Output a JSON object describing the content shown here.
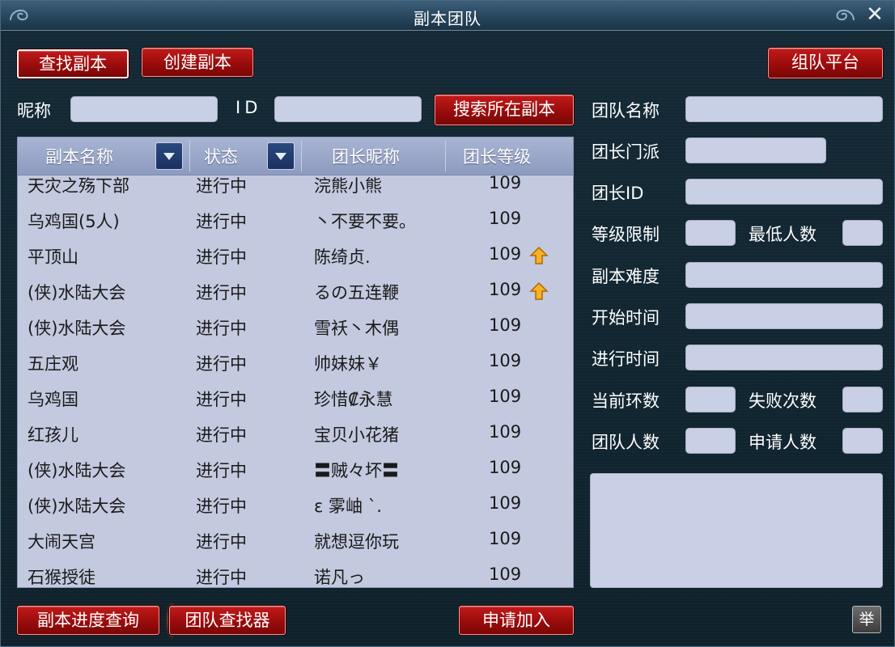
{
  "window": {
    "title": "副本团队",
    "close_glyph": "✕"
  },
  "toolbar": {
    "find_instance": "查找副本",
    "create_instance": "创建副本",
    "team_platform": "组队平台"
  },
  "search": {
    "nickname_label": "昵称",
    "nickname_value": "",
    "id_label": "ID",
    "id_value": "",
    "search_button": "搜索所在副本"
  },
  "list": {
    "columns": [
      "副本名称",
      "状态",
      "团长昵称",
      "团长等级"
    ],
    "rows": [
      {
        "name": "天灾之殇下部",
        "status": "进行中",
        "leader": "浣熊小熊",
        "level": "109",
        "up": false
      },
      {
        "name": "乌鸡国(5人)",
        "status": "进行中",
        "leader": "丶不要不要。",
        "level": "109",
        "up": false
      },
      {
        "name": "平顶山",
        "status": "进行中",
        "leader": "陈绮贞.",
        "level": "109",
        "up": true
      },
      {
        "name": "(侠)水陆大会",
        "status": "进行中",
        "leader": "るの五连鞭",
        "level": "109",
        "up": true
      },
      {
        "name": "(侠)水陆大会",
        "status": "进行中",
        "leader": "雪袄丶木偶",
        "level": "109",
        "up": false
      },
      {
        "name": "五庄观",
        "status": "进行中",
        "leader": "帅妹妹￥",
        "level": "109",
        "up": false
      },
      {
        "name": "乌鸡国",
        "status": "进行中",
        "leader": "珍惜₡永慧",
        "level": "109",
        "up": false
      },
      {
        "name": "红孩儿",
        "status": "进行中",
        "leader": "宝贝小花猪",
        "level": "109",
        "up": false
      },
      {
        "name": "(侠)水陆大会",
        "status": "进行中",
        "leader": "〓贼々坏〓",
        "level": "109",
        "up": false
      },
      {
        "name": "(侠)水陆大会",
        "status": "进行中",
        "leader": "ε 雺岫 `.",
        "level": "109",
        "up": false
      },
      {
        "name": "大闹天宫",
        "status": "进行中",
        "leader": "就想逗你玩",
        "level": "109",
        "up": false
      },
      {
        "name": "石猴授徒",
        "status": "进行中",
        "leader": "诺凡っ",
        "level": "109",
        "up": false
      }
    ]
  },
  "details": {
    "team_name": "团队名称",
    "leader_school": "团长门派",
    "leader_id": "团长ID",
    "level_limit": "等级限制",
    "min_members": "最低人数",
    "difficulty": "副本难度",
    "start_time": "开始时间",
    "elapsed_time": "进行时间",
    "current_round": "当前环数",
    "fail_count": "失败次数",
    "team_size": "团队人数",
    "applicants": "申请人数"
  },
  "footer": {
    "progress_query": "副本进度查询",
    "team_finder": "团队查找器",
    "apply_join": "申请加入",
    "report": "举"
  },
  "colors": {
    "button_red": "#b01212",
    "field": "#c9cfe4",
    "header": "#9aa6c8"
  }
}
